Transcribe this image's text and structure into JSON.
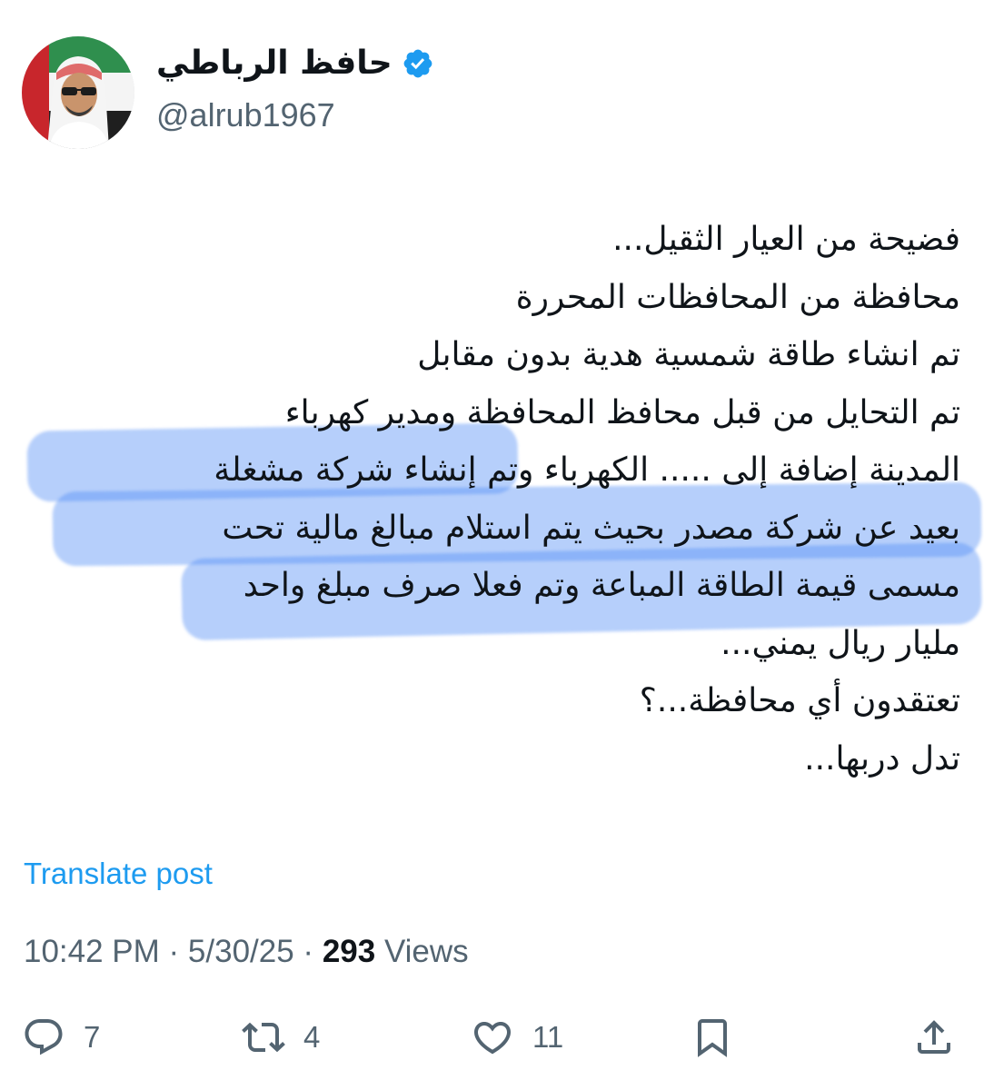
{
  "author": {
    "display_name": "حافظ الرباطي",
    "handle": "@alrub1967",
    "verified": true
  },
  "tweet": {
    "lines": [
      "فضيحة من العيار الثقيل...",
      "محافظة من المحافظات المحررة",
      "تم انشاء طاقة شمسية هدية بدون مقابل",
      "تم التحايل من قبل محافظ المحافظة ومدير كهرباء",
      "المدينة إضافة إلى ..... الكهرباء وتم إنشاء شركة مشغلة",
      "بعيد عن شركة مصدر بحيث يتم استلام مبالغ مالية تحت",
      "مسمى قيمة الطاقة المباعة وتم فعلا صرف مبلغ واحد",
      "مليار ريال يمني...",
      "تعتقدون أي محافظة...؟",
      "تدل دربها..."
    ]
  },
  "translate_label": "Translate post",
  "meta": {
    "time": "10:42 PM",
    "separator": " · ",
    "date": "5/30/25",
    "views_count": "293",
    "views_label": " Views"
  },
  "actions": {
    "replies": "7",
    "reposts": "4",
    "likes": "11"
  },
  "colors": {
    "link": "#1d9bf0",
    "secondary_text": "#536471",
    "primary_text": "#0f1419",
    "verified": "#1d9bf0",
    "highlighter": "#508cf5"
  },
  "icons": [
    "verified-badge-icon",
    "reply-icon",
    "repost-icon",
    "like-icon",
    "bookmark-icon",
    "share-icon"
  ]
}
